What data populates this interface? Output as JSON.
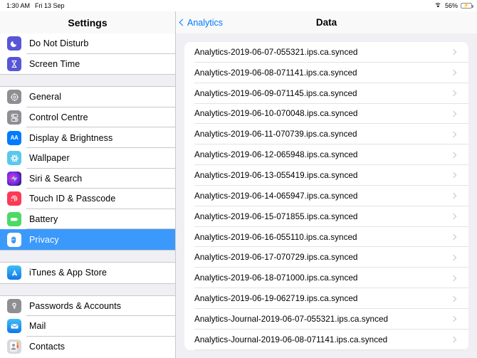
{
  "status_bar": {
    "time": "1:30 AM",
    "date": "Fri 13 Sep",
    "wifi_icon": "wifi-icon",
    "battery_percent": "56%",
    "battery_icon": "battery-charging-icon",
    "battery_color": "#4cd964"
  },
  "sidebar": {
    "title": "Settings",
    "selected": "Privacy",
    "selection_color": "#3b99fc",
    "groups": [
      {
        "items": [
          {
            "label": "Do Not Disturb",
            "icon": "moon-icon",
            "icon_color": "#5856d6"
          },
          {
            "label": "Screen Time",
            "icon": "hourglass-icon",
            "icon_color": "#5856d6"
          }
        ]
      },
      {
        "items": [
          {
            "label": "General",
            "icon": "gear-icon",
            "icon_color": "#8e8e93"
          },
          {
            "label": "Control Centre",
            "icon": "sliders-icon",
            "icon_color": "#8e8e93"
          },
          {
            "label": "Display & Brightness",
            "icon": "text-size-icon",
            "icon_color": "#007aff"
          },
          {
            "label": "Wallpaper",
            "icon": "flower-icon",
            "icon_color": "#5ac8ea"
          },
          {
            "label": "Siri & Search",
            "icon": "siri-icon",
            "icon_color": "#2b1b4a"
          },
          {
            "label": "Touch ID & Passcode",
            "icon": "fingerprint-icon",
            "icon_color": "#fb3b56"
          },
          {
            "label": "Battery",
            "icon": "battery-icon",
            "icon_color": "#4cd964"
          },
          {
            "label": "Privacy",
            "icon": "hand-icon",
            "icon_color": "#007aff"
          }
        ]
      },
      {
        "items": [
          {
            "label": "iTunes & App Store",
            "icon": "app-store-icon",
            "icon_color": "#1f9bf0"
          }
        ]
      },
      {
        "items": [
          {
            "label": "Passwords & Accounts",
            "icon": "key-icon",
            "icon_color": "#8e8e93"
          },
          {
            "label": "Mail",
            "icon": "mail-icon",
            "icon_color": "#1f9bf0"
          },
          {
            "label": "Contacts",
            "icon": "contacts-icon",
            "icon_color": "#8e8e93"
          }
        ]
      }
    ]
  },
  "detail": {
    "back_label": "Analytics",
    "back_icon": "chevron-left-icon",
    "title": "Data",
    "disclosure_icon": "chevron-right-icon",
    "files": [
      "Analytics-2019-06-07-055321.ips.ca.synced",
      "Analytics-2019-06-08-071141.ips.ca.synced",
      "Analytics-2019-06-09-071145.ips.ca.synced",
      "Analytics-2019-06-10-070048.ips.ca.synced",
      "Analytics-2019-06-11-070739.ips.ca.synced",
      "Analytics-2019-06-12-065948.ips.ca.synced",
      "Analytics-2019-06-13-055419.ips.ca.synced",
      "Analytics-2019-06-14-065947.ips.ca.synced",
      "Analytics-2019-06-15-071855.ips.ca.synced",
      "Analytics-2019-06-16-055110.ips.ca.synced",
      "Analytics-2019-06-17-070729.ips.ca.synced",
      "Analytics-2019-06-18-071000.ips.ca.synced",
      "Analytics-2019-06-19-062719.ips.ca.synced",
      "Analytics-Journal-2019-06-07-055321.ips.ca.synced",
      "Analytics-Journal-2019-06-08-071141.ips.ca.synced"
    ]
  }
}
